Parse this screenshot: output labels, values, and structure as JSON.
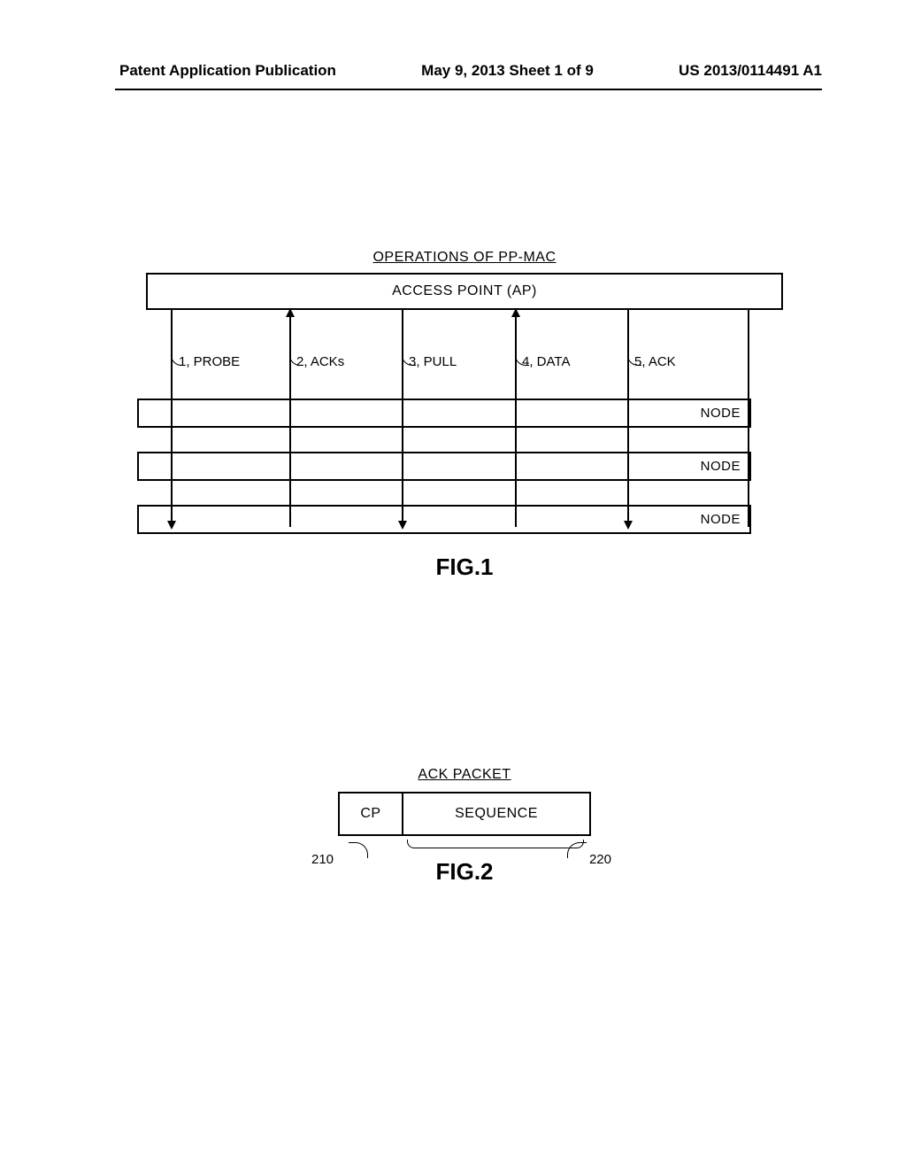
{
  "header": {
    "left": "Patent Application Publication",
    "center": "May 9, 2013  Sheet 1 of 9",
    "right": "US 2013/0114491 A1"
  },
  "fig1": {
    "title": "OPERATIONS OF PP-MAC",
    "ap_label": "ACCESS POINT (AP)",
    "cols": {
      "c1": "1, PROBE",
      "c2": "2, ACKs",
      "c3": "3, PULL",
      "c4": "4, DATA",
      "c5": "5, ACK"
    },
    "node_label": "NODE",
    "caption": "FIG.1"
  },
  "fig2": {
    "title": "ACK PACKET",
    "cp": "CP",
    "seq": "SEQUENCE",
    "ref210": "210",
    "ref220": "220",
    "caption": "FIG.2"
  }
}
